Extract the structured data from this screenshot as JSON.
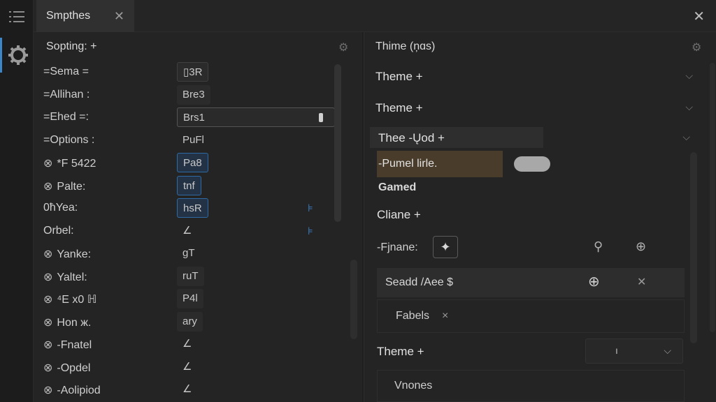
{
  "window": {
    "tab_title": "Smpthes",
    "tab_close": "✕",
    "close": "✕"
  },
  "left": {
    "header": "Sopting: +",
    "rows": [
      {
        "label": "=Sema =",
        "icon": "",
        "value": "▯3R",
        "style": "boxed",
        "side": ""
      },
      {
        "label": "=Allihan :",
        "icon": "",
        "value": "Bre3",
        "style": "filled",
        "side": ""
      },
      {
        "label": "=Ehed =:",
        "icon": "",
        "value": "Brs1",
        "style": "wide",
        "side": ""
      },
      {
        "label": "=Options :",
        "icon": "",
        "value": "PuFl",
        "style": "plain",
        "side": ""
      },
      {
        "label": "*F 5422",
        "icon": "⊗",
        "value": "Pa8",
        "style": "blue",
        "side": ""
      },
      {
        "label": "Palte:",
        "icon": "⊗",
        "value": "tnf",
        "style": "blue",
        "side": ""
      },
      {
        "label": "0ħYea:",
        "icon": "",
        "value": "hsR",
        "style": "blue",
        "side": "⊧"
      },
      {
        "label": "Orbel:",
        "icon": "",
        "value": "∠",
        "style": "pen",
        "side": "⊧"
      },
      {
        "label": "Yanke:",
        "icon": "⊗",
        "value": "gT",
        "style": "plain",
        "side": ""
      },
      {
        "label": "Yaltel:",
        "icon": "⊗",
        "value": "ruT",
        "style": "filled",
        "side": ""
      },
      {
        "label": "⁴E x0 ℍ",
        "icon": "⊗",
        "value": "P4l",
        "style": "filled",
        "side": ""
      },
      {
        "label": "Hon ж.",
        "icon": "⊗",
        "value": "ary",
        "style": "filled",
        "side": ""
      },
      {
        "label": "-Fnatel",
        "icon": "⊗",
        "value": "∠",
        "style": "pen",
        "side": ""
      },
      {
        "label": "-Opdel",
        "icon": "⊗",
        "value": "∠",
        "style": "pen",
        "side": ""
      },
      {
        "label": "-Aolipiod",
        "icon": "⊗",
        "value": "∠",
        "style": "pen",
        "side": ""
      }
    ]
  },
  "right": {
    "header": "Thime (ņɑs)",
    "theme1": "Theme +",
    "theme2": "Theme +",
    "theme3": "Thee -Ųod +",
    "brown_label": "-Pumel lirle.",
    "gamed": "Gamed",
    "claine": "Cliane +",
    "fname": "-Fjnane:",
    "search": "Seadd /Aee $",
    "fabels": "Fabels",
    "fabels_x": "×",
    "theme4": "Theme +",
    "select_value": "ı",
    "vnones": "Vnones"
  },
  "icons": {
    "explorer": "list-icon",
    "settings": "gear-icon",
    "chevron": "chevron-down-icon",
    "sparkle": "sparkle-icon",
    "search": "search-icon",
    "info": "info-icon"
  },
  "colors": {
    "accent": "#3a86c8",
    "brown_highlight": "#4a3c2a"
  }
}
